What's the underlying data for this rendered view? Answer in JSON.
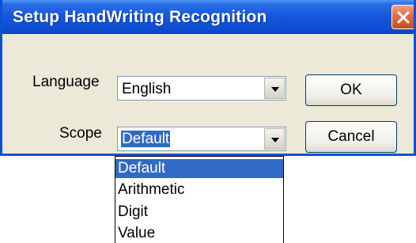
{
  "window": {
    "title": "Setup HandWriting Recognition"
  },
  "language": {
    "label": "Language",
    "value": "English"
  },
  "scope": {
    "label": "Scope",
    "value": "Default",
    "options": [
      "Default",
      "Arithmetic",
      "Digit",
      "Value"
    ],
    "selected_index": 0
  },
  "buttons": {
    "ok_label": "OK",
    "cancel_label": "Cancel"
  },
  "colors": {
    "titlebar": "#1658dd",
    "selection": "#316ac5",
    "dialog_bg": "#ece9d8"
  }
}
